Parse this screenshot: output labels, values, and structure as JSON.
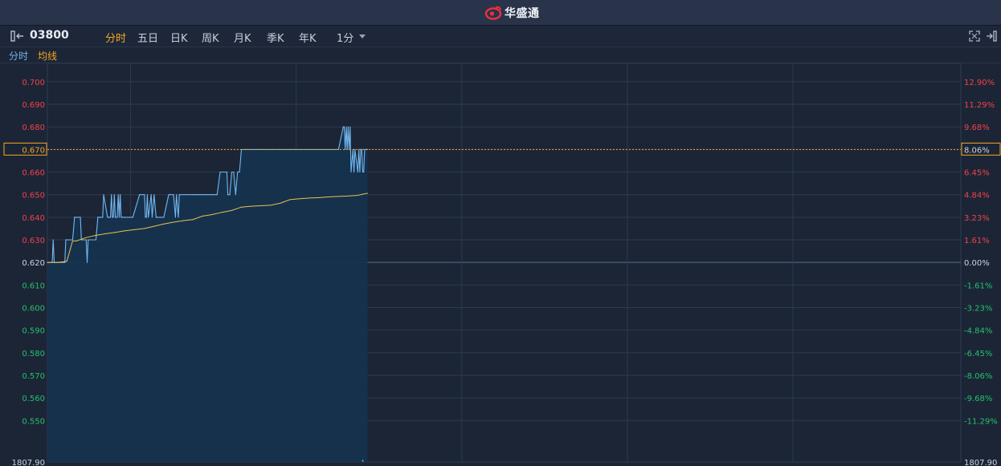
{
  "header": {
    "brand_name": "华盛通"
  },
  "toolbar": {
    "stock_code": "03800",
    "tabs": [
      {
        "label": "分时",
        "active": true
      },
      {
        "label": "五日",
        "active": false
      },
      {
        "label": "日K",
        "active": false
      },
      {
        "label": "周K",
        "active": false
      },
      {
        "label": "月K",
        "active": false
      },
      {
        "label": "季K",
        "active": false
      },
      {
        "label": "年K",
        "active": false
      }
    ],
    "interval_label": "1分"
  },
  "legend": {
    "intraday_label": "分时",
    "avg_label": "均线"
  },
  "colors": {
    "background": "#1c2536",
    "grid": "#2e3a50",
    "price_line": "#71b7f0",
    "area_fill": "#16324e",
    "avg_line": "#e8c252",
    "up": "#f0424a",
    "down": "#22c16c",
    "accent": "#f5a623",
    "neutral_label": "#cdd3de"
  },
  "chart_data": {
    "type": "line",
    "prev_close": 0.62,
    "current_price": 0.67,
    "current_pct": "8.06%",
    "ylim": [
      0.543,
      0.706
    ],
    "price_ticks": [
      "0.700",
      "0.690",
      "0.680",
      "0.670",
      "0.660",
      "0.650",
      "0.640",
      "0.630",
      "0.620",
      "0.610",
      "0.600",
      "0.590",
      "0.580",
      "0.570",
      "0.560",
      "0.550"
    ],
    "pct_ticks": [
      "12.90%",
      "11.29%",
      "9.68%",
      "8.06%",
      "6.45%",
      "4.84%",
      "3.23%",
      "1.61%",
      "0.00%",
      "-1.61%",
      "-3.23%",
      "-4.84%",
      "-6.45%",
      "-8.06%",
      "-9.68%",
      "-11.29%"
    ],
    "volume_axis_left": "1807.90",
    "volume_axis_right": "1807.90",
    "session_minutes": 330,
    "series": [
      {
        "name": "分时",
        "x": [
          0,
          5,
          6,
          7,
          8,
          10,
          18,
          19,
          20,
          21,
          26,
          28,
          34,
          35,
          36,
          40,
          41,
          42,
          50,
          52,
          53,
          55,
          57,
          58,
          62,
          63,
          64,
          65,
          66,
          67,
          68,
          69,
          70,
          71,
          72,
          73,
          74,
          75,
          76,
          77,
          78,
          88,
          95,
          100,
          101,
          102,
          103,
          104,
          107,
          108,
          110,
          112,
          113,
          120,
          125,
          130,
          132,
          133,
          135,
          136,
          143,
          150,
          152,
          154,
          155,
          157,
          160,
          165,
          168,
          170,
          175,
          178,
          184,
          185,
          186,
          188,
          190,
          192,
          194,
          196,
          198,
          200,
          205,
          215,
          220,
          225,
          232,
          250,
          280,
          300,
          305,
          306,
          307,
          308,
          309,
          310,
          311,
          312,
          313,
          315,
          316,
          317,
          320,
          321,
          322,
          323,
          324,
          325,
          326,
          327,
          328,
          329,
          330
        ],
        "values": [
          0.62,
          0.62,
          0.63,
          0.62,
          0.62,
          0.62,
          0.62,
          0.63,
          0.63,
          0.63,
          0.63,
          0.64,
          0.64,
          0.63,
          0.63,
          0.63,
          0.62,
          0.63,
          0.63,
          0.64,
          0.64,
          0.64,
          0.64,
          0.65,
          0.64,
          0.64,
          0.64,
          0.64,
          0.65,
          0.64,
          0.64,
          0.65,
          0.64,
          0.64,
          0.64,
          0.65,
          0.64,
          0.65,
          0.64,
          0.64,
          0.64,
          0.64,
          0.65,
          0.65,
          0.64,
          0.64,
          0.65,
          0.64,
          0.65,
          0.64,
          0.65,
          0.64,
          0.64,
          0.64,
          0.65,
          0.65,
          0.64,
          0.65,
          0.64,
          0.65,
          0.65,
          0.65,
          0.65,
          0.65,
          0.65,
          0.65,
          0.65,
          0.65,
          0.65,
          0.65,
          0.65,
          0.66,
          0.66,
          0.66,
          0.65,
          0.65,
          0.66,
          0.66,
          0.65,
          0.66,
          0.66,
          0.67,
          0.67,
          0.67,
          0.67,
          0.67,
          0.67,
          0.67,
          0.67,
          0.67,
          0.68,
          0.68,
          0.67,
          0.68,
          0.67,
          0.68,
          0.67,
          0.68,
          0.66,
          0.67,
          0.66,
          0.67,
          0.66,
          0.67,
          0.66,
          0.67,
          0.67,
          0.66,
          0.66,
          0.67,
          0.67,
          0.67,
          0.67
        ]
      },
      {
        "name": "均线",
        "x": [
          0,
          10,
          20,
          26,
          30,
          40,
          50,
          60,
          70,
          80,
          90,
          100,
          110,
          120,
          130,
          140,
          150,
          160,
          170,
          180,
          190,
          200,
          210,
          220,
          230,
          240,
          250,
          260,
          270,
          280,
          290,
          300,
          310,
          320,
          325,
          330
        ],
        "values": [
          0.62,
          0.62,
          0.6205,
          0.6295,
          0.6295,
          0.631,
          0.632,
          0.6327,
          0.6333,
          0.634,
          0.6345,
          0.635,
          0.636,
          0.637,
          0.6378,
          0.6385,
          0.639,
          0.6405,
          0.6412,
          0.6422,
          0.643,
          0.6445,
          0.6449,
          0.6451,
          0.6453,
          0.6462,
          0.6478,
          0.6482,
          0.6485,
          0.6487,
          0.649,
          0.6492,
          0.6494,
          0.6497,
          0.6502,
          0.6506
        ]
      }
    ]
  }
}
